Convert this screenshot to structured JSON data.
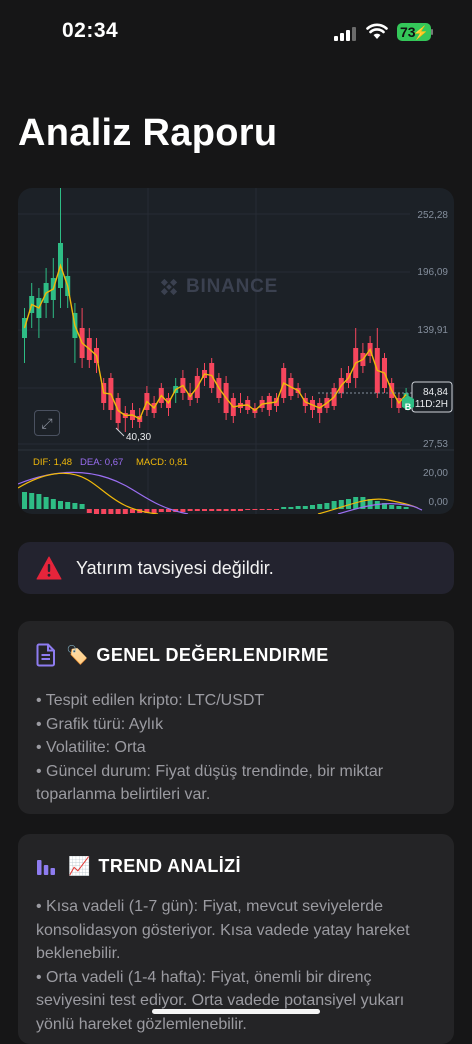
{
  "status_bar": {
    "time": "02:34",
    "battery": "73"
  },
  "page": {
    "title": "Analiz Raporu"
  },
  "chart": {
    "watermark": "BINANCE",
    "price_labels": [
      "252,28",
      "196,09",
      "139,91",
      "27,53"
    ],
    "current_price": "84,84",
    "countdown": "11D:2H",
    "low_marker": "40,30",
    "buy_marker": "B",
    "macd": {
      "dif": "DIF: 1,48",
      "dea": "DEA: 0,67",
      "macd": "MACD: 0,81"
    },
    "macd_levels": [
      "20,00",
      "0,00"
    ],
    "colors": {
      "up": "#2ebd85",
      "down": "#f6465d",
      "ma": "#f0b90b",
      "dea": "#9b6ef3"
    }
  },
  "disclaimer": {
    "text": "Yatırım tavsiyesi değildir."
  },
  "sections": [
    {
      "emoji": "🏷️",
      "title": "GENEL DEĞERLENDIRME",
      "items": [
        "• Tespit edilen kripto: LTC/USDT",
        "• Grafik türü: Aylık",
        "• Volatilite: Orta",
        "• Güncel durum: Fiyat düşüş trendinde, bir miktar toparlanma belirtileri var."
      ]
    },
    {
      "emoji": "📈",
      "title": "TREND ANALİZİ",
      "items": [
        "• Kısa vadeli (1-7 gün): Fiyat, mevcut seviyelerde konsolidasyon gösteriyor. Kısa vadede yatay hareket beklenebilir.",
        "• Orta vadeli (1-4 hafta): Fiyat, önemli bir direnç seviyesini test ediyor. Orta vadede potansiyel yukarı yönlü hareket gözlemlenebilir."
      ]
    }
  ]
}
